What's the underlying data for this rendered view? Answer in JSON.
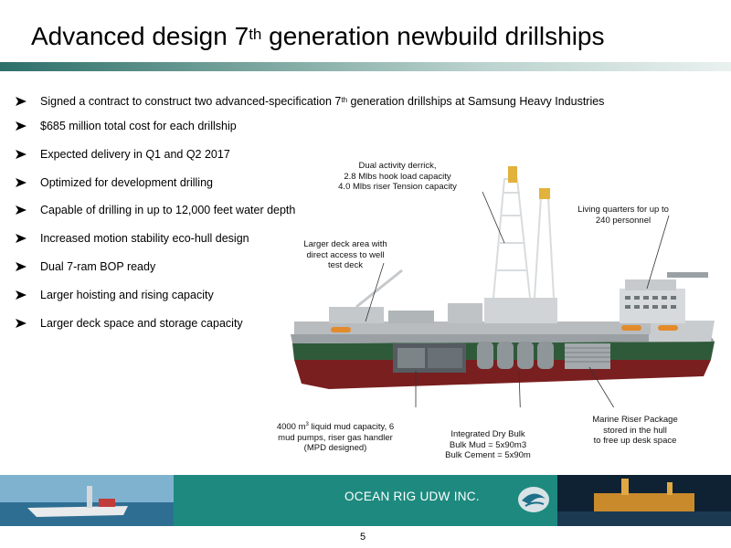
{
  "title": {
    "main": "Advanced design 7",
    "sup": "th",
    "rest": " generation newbuild drillships"
  },
  "bullets": {
    "b1": {
      "pre": "Signed a contract to construct two advanced-specification 7",
      "sup": "th",
      "post": " generation drillships at Samsung Heavy Industries"
    },
    "b2": "$685 million total cost for each drillship",
    "b3": "Expected delivery in Q1 and Q2 2017",
    "b4": "Optimized for development drilling",
    "b5": "Capable of drilling in up to 12,000 feet water depth",
    "b6": "Increased motion stability eco-hull design",
    "b7": "Dual 7-ram BOP ready",
    "b8": "Larger hoisting and rising capacity",
    "b9": "Larger deck space and storage capacity"
  },
  "callouts": {
    "derrick": {
      "l1": "Dual activity derrick,",
      "l2": "2.8 Mlbs hook load capacity",
      "l3": "4.0 Mlbs riser Tension capacity"
    },
    "living": {
      "l1": "Living quarters for up to",
      "l2": "240 personnel"
    },
    "deck": {
      "l1": "Larger deck area with",
      "l2": "direct access to well",
      "l3": "test deck"
    },
    "mud": {
      "l1a": "4000 m",
      "l1sup": "3",
      "l1b": " liquid mud capacity, 6",
      "l2": "mud pumps, riser gas handler",
      "l3": "(MPD designed)"
    },
    "bulk": {
      "l1": "Integrated Dry Bulk",
      "l2": "Bulk Mud = 5x90m3",
      "l3": "Bulk Cement = 5x90m"
    },
    "riser": {
      "l1": "Marine Riser Package",
      "l2": "stored in the hull",
      "l3": "to free up desk space"
    }
  },
  "footer": {
    "company": "OCEAN RIG UDW INC.",
    "page": "5"
  },
  "colors": {
    "accent": "#1e8a7f",
    "hull_red": "#7a1f1f",
    "hull_green": "#2f5a3a"
  }
}
